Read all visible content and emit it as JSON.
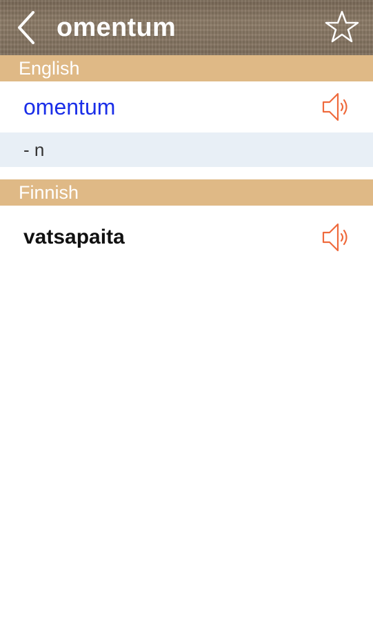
{
  "nav": {
    "back_icon": "chevron-left-icon",
    "title": "omentum",
    "favorite_icon": "star-outline-icon"
  },
  "sections": [
    {
      "header": "English",
      "word": "omentum",
      "word_color": "#1a2ee8",
      "part_of_speech": "- n",
      "speaker_icon": "speaker-icon"
    },
    {
      "header": "Finnish",
      "word": "vatsapaita",
      "word_color": "#111111",
      "speaker_icon": "speaker-icon"
    }
  ],
  "colors": {
    "section_header_bg": "#dfb986",
    "speaker_accent": "#ef6a3c",
    "pos_row_bg": "#e8eff6"
  }
}
